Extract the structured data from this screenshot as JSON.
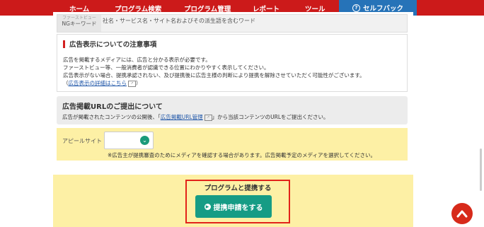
{
  "nav": {
    "items": [
      "ホーム",
      "プログラム検索",
      "プログラム管理",
      "レポート",
      "ツール"
    ],
    "selfpack_label": "セルフバック",
    "selfpack_icon": "question-circle-icon"
  },
  "ngkeyword": {
    "label_top": "ファーストビュー",
    "label": "NGキーワード",
    "value": "社名・サービス名・サイト名およびその派生語を含むワード"
  },
  "notice": {
    "title": "広告表示についての注意事項",
    "line1": "広告を掲載するメディアには、広告と分かる表示が必要です。",
    "line2": "ファーストビュー等、一般消費者が認識できる位置にわかりやすく表示してください。",
    "line3": "広告表示がない場合、提携承認されない、及び提携後に広告主様の判断により提携を解除させていただく可能性がございます。",
    "link_open": "（",
    "link": "広告表示の詳細はこちら",
    "link_close": "）"
  },
  "url_section": {
    "title": "広告掲載URLのご提出について",
    "text_before": "広告が掲載されたコンテンツの公開後、「",
    "link": "広告掲載URL管理",
    "text_after": "」から当該コンテンツのURLをご提出ください。"
  },
  "appeal": {
    "label": "アピールサイト",
    "selected": "",
    "note": "※広告主が提携審査のためにメディアを確認する場合があります。広告掲載予定のメディアを選択してください。"
  },
  "cta": {
    "title": "プログラムと提携する",
    "button": "提携申請をする"
  },
  "colors": {
    "nav_red": "#cc1a1a",
    "selfpack_blue": "#2673b8",
    "cta_green": "#169c85",
    "highlight_yellow": "#fdf0a5",
    "frame_red": "#e2231a"
  }
}
